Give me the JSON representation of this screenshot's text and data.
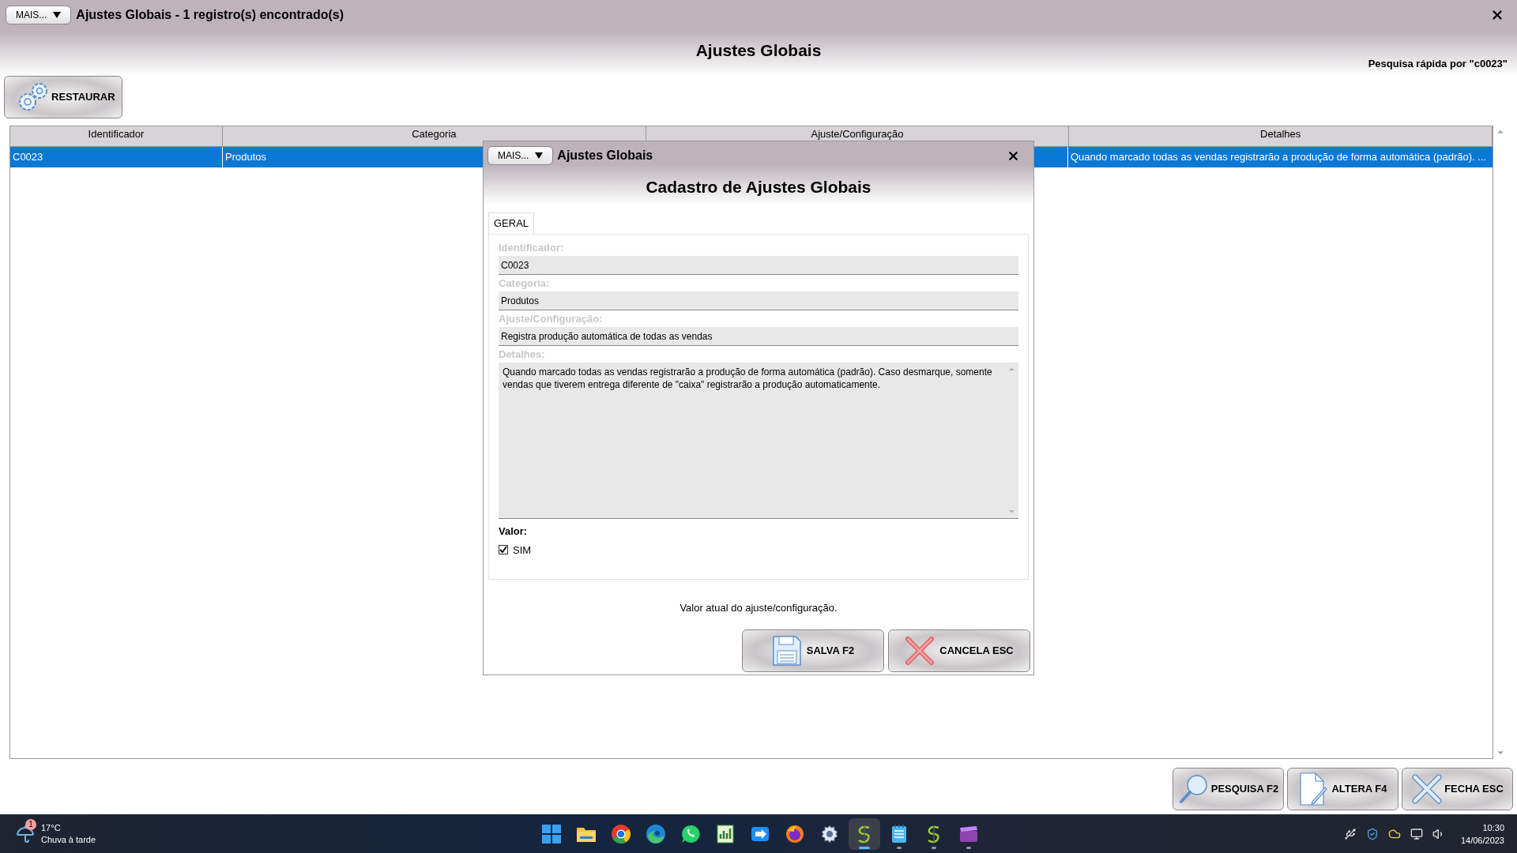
{
  "window": {
    "menu_button": "MAIS...",
    "title": "Ajustes Globais - 1 registro(s) encontrado(s)"
  },
  "header": {
    "title": "Ajustes Globais",
    "quick_search": "Pesquisa rápida por \"c0023\""
  },
  "toolbar": {
    "restore_button": "RESTAURAR"
  },
  "table": {
    "columns": [
      "Identificador",
      "Categoria",
      "Ajuste/Configuração",
      "Detalhes"
    ],
    "rows": [
      {
        "selected": true,
        "identificador": "C0023",
        "categoria": "Produtos",
        "detalhes": "Quando marcado todas as vendas registrarão a produção de forma automática (padrão). ..."
      }
    ]
  },
  "actions": [
    {
      "label": "PESQUISA F2",
      "kind": "search"
    },
    {
      "label": "ALTERA F4",
      "kind": "edit"
    },
    {
      "label": "FECHA ESC",
      "kind": "close"
    }
  ],
  "dialog": {
    "menu_button": "MAIS...",
    "title": "Ajustes Globais",
    "heading": "Cadastro de Ajustes Globais",
    "tabs": [
      {
        "label": "GERAL",
        "selected": true
      }
    ],
    "fields": [
      {
        "label": "Identificador:",
        "value": "C0023",
        "kind": "input"
      },
      {
        "label": "Categoria:",
        "value": "Produtos",
        "kind": "input"
      },
      {
        "label": "Ajuste/Configuração:",
        "value": "Registra produção automática de todas as vendas",
        "kind": "input"
      },
      {
        "label": "Detalhes:",
        "value": "Quando marcado todas as vendas registrarão a produção de forma automática (padrão). Caso desmarque, somente vendas que tiverem entrega diferente de \"caixa\" registrarão a produção automaticamente.",
        "kind": "textarea"
      }
    ],
    "value_label": "Valor:",
    "checkbox": {
      "label": "SIM",
      "checked": true
    },
    "hint": "Valor atual do ajuste/configuração.",
    "buttons": [
      {
        "label": "SALVA F2",
        "kind": "save"
      },
      {
        "label": "CANCELA ESC",
        "kind": "cancel"
      }
    ]
  },
  "taskbar": {
    "weather": {
      "temperature": "17°C",
      "forecast": "Chuva à tarde",
      "badge": "1"
    },
    "apps": [
      {
        "kind": "start",
        "selected": false,
        "running": false
      },
      {
        "kind": "folder",
        "selected": false,
        "running": false
      },
      {
        "kind": "chrome",
        "selected": false,
        "running": false
      },
      {
        "kind": "edge",
        "selected": false,
        "running": false
      },
      {
        "kind": "chat",
        "selected": false,
        "running": false
      },
      {
        "kind": "sheet",
        "selected": false,
        "running": false
      },
      {
        "kind": "remote",
        "selected": false,
        "running": false
      },
      {
        "kind": "firefox",
        "selected": false,
        "running": false
      },
      {
        "kind": "gear",
        "selected": false,
        "running": false
      },
      {
        "kind": "sapp",
        "selected": true,
        "running": true
      },
      {
        "kind": "notepad",
        "selected": false,
        "running": true
      },
      {
        "kind": "sapp",
        "selected": false,
        "running": true
      },
      {
        "kind": "video",
        "selected": false,
        "running": true
      }
    ],
    "clock": {
      "time": "10:30",
      "date": "14/06/2023"
    }
  }
}
